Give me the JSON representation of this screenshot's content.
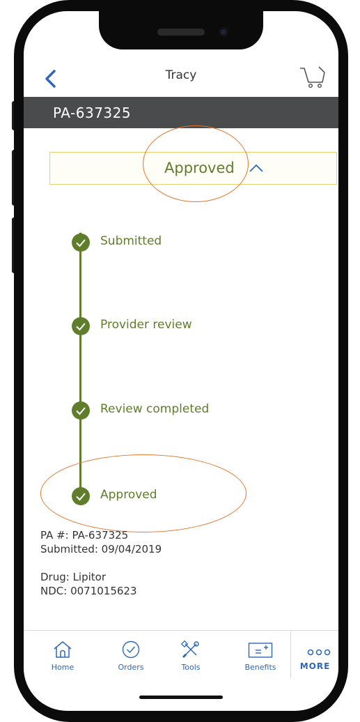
{
  "header": {
    "title": "Tracy",
    "back_icon": "chevron-left-icon",
    "cart_icon": "cart-icon"
  },
  "titlebar": {
    "text": "PA-637325"
  },
  "status": {
    "label": "Approved",
    "icon": "chevron-up-icon"
  },
  "timeline": {
    "steps": [
      {
        "label": "Submitted",
        "done": true
      },
      {
        "label": "Provider review",
        "done": true
      },
      {
        "label": "Review completed",
        "done": true
      },
      {
        "label": "Approved",
        "done": true
      }
    ]
  },
  "details": {
    "pa_number": "PA #: PA-637325",
    "submitted": "Submitted: 09/04/2019",
    "drug": "Drug: Lipitor",
    "ndc": "NDC: 0071015623"
  },
  "nav": {
    "items": [
      {
        "label": "Home",
        "icon": "home-icon"
      },
      {
        "label": "Orders",
        "icon": "check-circle-icon"
      },
      {
        "label": "Tools",
        "icon": "tools-icon"
      },
      {
        "label": "Benefits",
        "icon": "card-icon"
      }
    ],
    "more_label": "MORE",
    "more_icon": "more-dots-icon"
  },
  "colors": {
    "accent_green": "#5f7d2a",
    "accent_blue": "#2e66b8",
    "title_bar": "#4a4b4d",
    "status_border": "#e6cf74",
    "annotation": "#e2762f"
  }
}
